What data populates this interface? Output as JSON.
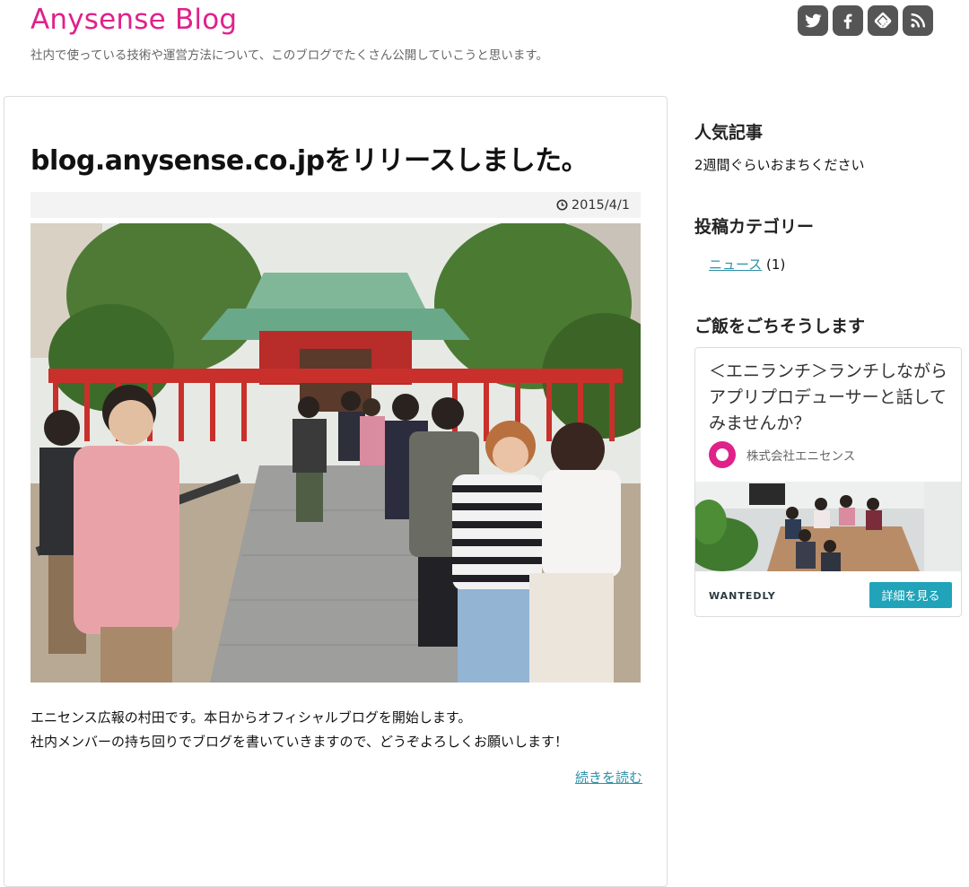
{
  "site": {
    "title": "Anysense Blog",
    "description": "社内で使っている技術や運営方法について、このブログでたくさん公開していこうと思います。",
    "brand_color": "#e0218a"
  },
  "social": [
    {
      "icon": "twitter-icon"
    },
    {
      "icon": "facebook-icon"
    },
    {
      "icon": "feedly-icon"
    },
    {
      "icon": "rss-icon"
    }
  ],
  "post": {
    "title": "blog.anysense.co.jpをリリースしました。",
    "date": "2015/4/1",
    "body": [
      "エニセンス広報の村田です。本日からオフィシャルブログを開始します。",
      "社内メンバーの持ち回りでブログを書いていきますので、どうぞよろしくお願いします！"
    ],
    "read_more": "続きを読む"
  },
  "sidebar": {
    "popular": {
      "title": "人気記事",
      "text": "2週間ぐらいおまちください"
    },
    "categories": {
      "title": "投稿カテゴリー",
      "items": [
        {
          "label": "ニュース",
          "count": "(1)"
        }
      ]
    },
    "lunch": {
      "title": "ご飯をごちそうします",
      "card": {
        "title": "＜エニランチ＞ランチしながらアプリプロデューサーと話してみませんか？",
        "company": "株式会社エニセンス",
        "brand": "WANTEDLY",
        "button": "詳細を見る"
      }
    }
  },
  "colors": {
    "link": "#2f8fa6",
    "button": "#21a3b9",
    "social_bg": "#555555"
  }
}
